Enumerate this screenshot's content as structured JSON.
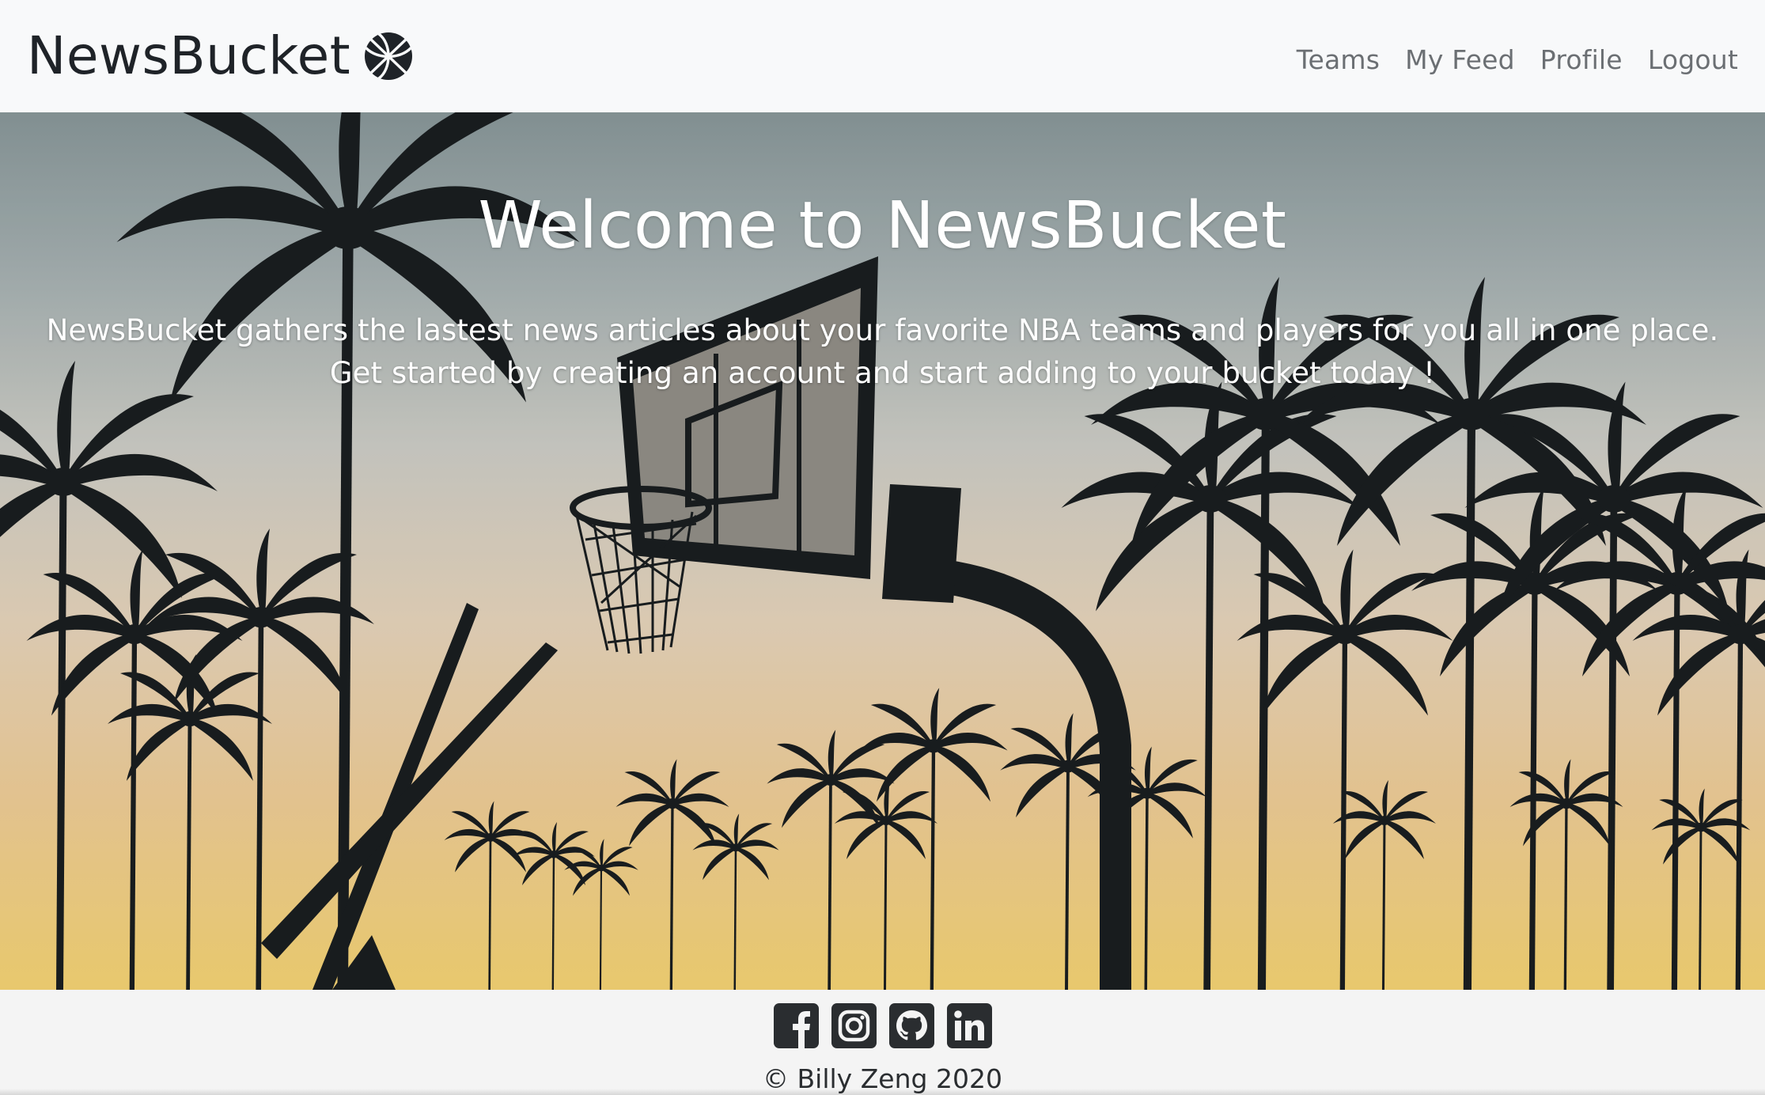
{
  "navbar": {
    "brand": "NewsBucket",
    "brand_icon": "basketball-icon",
    "links": [
      "Teams",
      "My Feed",
      "Profile",
      "Logout"
    ]
  },
  "hero": {
    "title": "Welcome to NewsBucket",
    "line1": "NewsBucket gathers the lastest news articles about your favorite NBA teams and players for you all in one place.",
    "line2": "Get started by creating an account and start adding to your bucket today !",
    "background": "basketball hoop and palm trees silhouette at sunset"
  },
  "footer": {
    "social": [
      "facebook-icon",
      "instagram-icon",
      "github-icon",
      "linkedin-icon"
    ],
    "copyright": "© Billy Zeng 2020"
  },
  "colors": {
    "navbar_bg": "#f8f9fa",
    "nav_link": "#6b6f73",
    "brand": "#1f2328",
    "hero_text": "#ffffff",
    "footer_bg": "#f4f4f4",
    "icon": "#2a2d30"
  }
}
